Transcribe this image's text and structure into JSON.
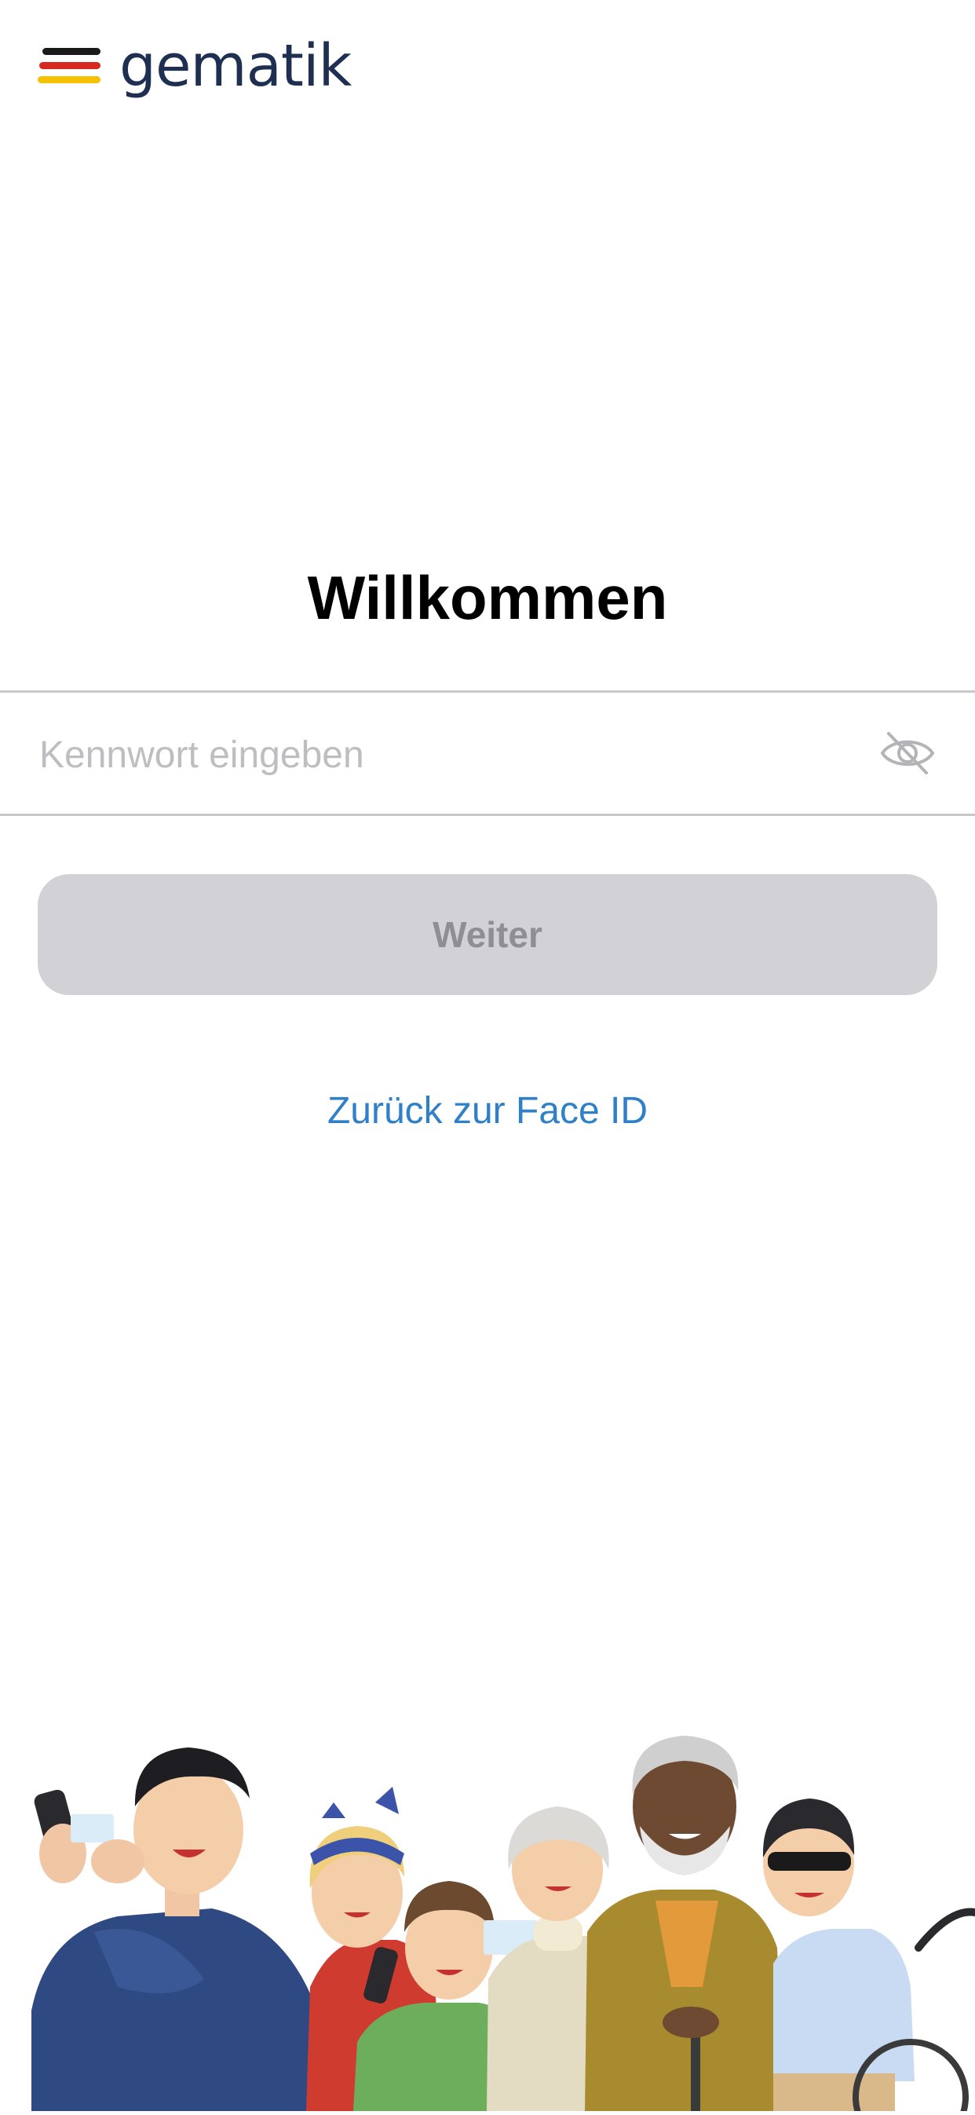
{
  "brand": {
    "name": "gematik",
    "colors": {
      "text": "#1f2f52",
      "black": "#1a1a1a",
      "red": "#d6281e",
      "gold": "#f6c100"
    }
  },
  "welcome": {
    "title": "Willkommen"
  },
  "password": {
    "placeholder": "Kennwort eingeben",
    "value": "",
    "visibility_icon": "eye-slash-icon"
  },
  "actions": {
    "continue_label": "Weiter",
    "back_to_faceid_label": "Zurück zur Face ID"
  },
  "illustration": {
    "icon": "people-group-illustration"
  },
  "colors": {
    "accent": "#2f7fc9",
    "button_bg": "#d1d1d6",
    "button_text": "#8e8e93",
    "divider": "#c8c8cc"
  }
}
